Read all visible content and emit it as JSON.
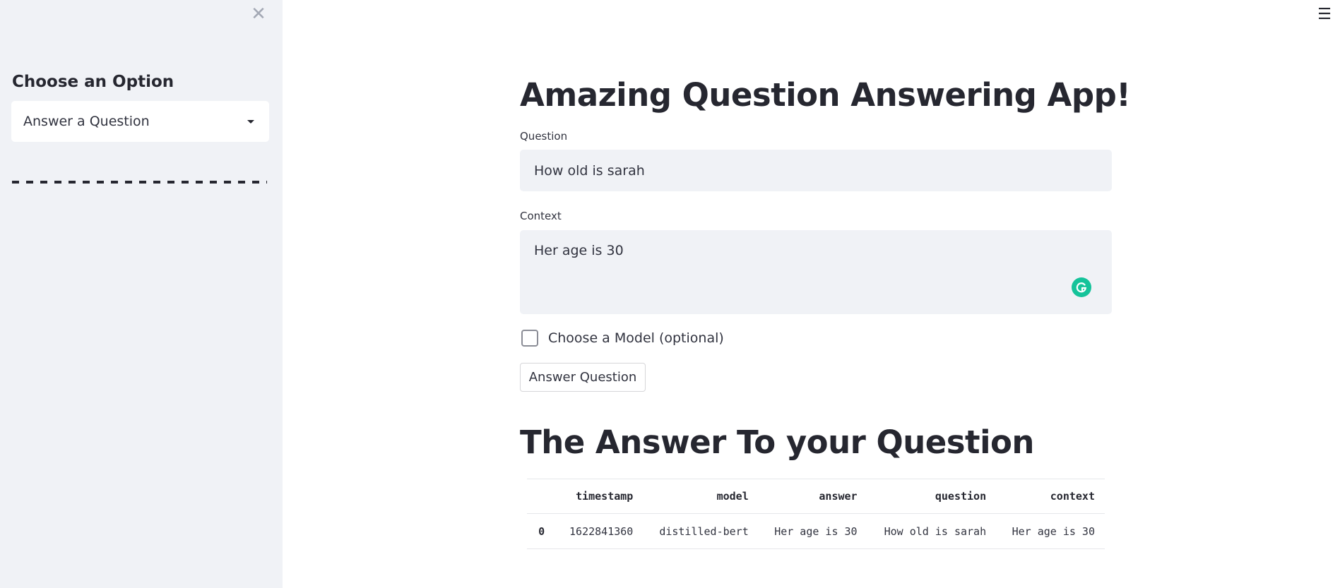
{
  "sidebar": {
    "heading": "Choose an Option",
    "select": {
      "value": "Answer a Question"
    },
    "close_icon": "close-icon"
  },
  "main": {
    "title": "Amazing Question Answering App!",
    "question": {
      "label": "Question",
      "value": "How old is sarah"
    },
    "context": {
      "label": "Context",
      "value": "Her age is 30"
    },
    "model_checkbox": {
      "label": "Choose a Model (optional)",
      "checked": false
    },
    "answer_button": {
      "label": "Answer Question"
    },
    "answer_section_title": "The Answer To your Question",
    "table": {
      "columns": [
        "",
        "timestamp",
        "model",
        "answer",
        "question",
        "context"
      ],
      "rows": [
        {
          "index": "0",
          "timestamp": "1622841360",
          "model": "distilled-bert",
          "answer": "Her age is 30",
          "question": "How old is sarah",
          "context": "Her age is 30"
        }
      ]
    }
  },
  "icons": {
    "menu": "hamburger-menu-icon",
    "grammarly": "grammarly-icon"
  },
  "colors": {
    "sidebar_bg": "#f0f2f6",
    "input_bg": "#f0f2f6",
    "text": "#262730",
    "grammarly": "#15c39a"
  }
}
